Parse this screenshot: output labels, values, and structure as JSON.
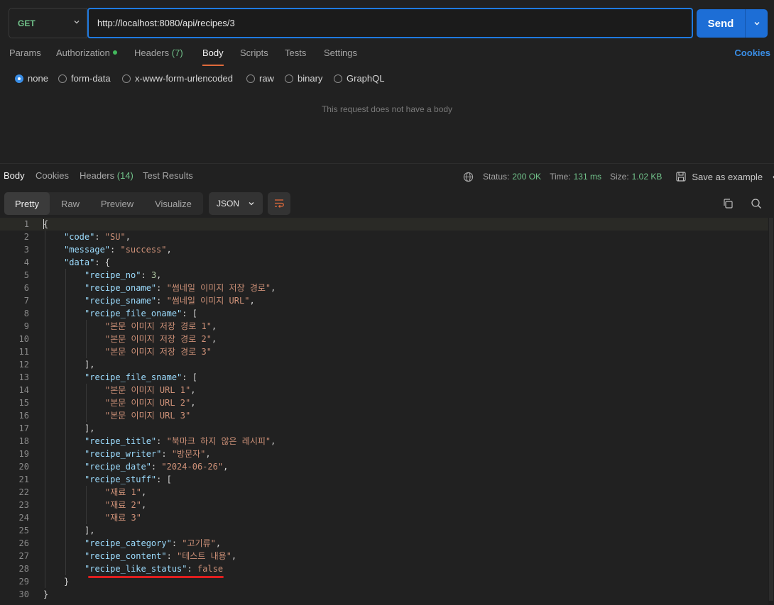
{
  "request": {
    "method": "GET",
    "url": "http://localhost:8080/api/recipes/3",
    "send_label": "Send"
  },
  "req_tabs": {
    "params": "Params",
    "authorization": "Authorization",
    "headers": "Headers",
    "headers_count": "(7)",
    "body": "Body",
    "scripts": "Scripts",
    "tests": "Tests",
    "settings": "Settings",
    "cookies": "Cookies"
  },
  "body_modes": [
    "none",
    "form-data",
    "x-www-form-urlencoded",
    "raw",
    "binary",
    "GraphQL"
  ],
  "no_body_text": "This request does not have a body",
  "response": {
    "tabs": {
      "body": "Body",
      "cookies": "Cookies",
      "headers": "Headers",
      "headers_count": "(14)",
      "test_results": "Test Results"
    },
    "status_label": "Status:",
    "status_value": "200 OK",
    "time_label": "Time:",
    "time_value": "131 ms",
    "size_label": "Size:",
    "size_value": "1.02 KB",
    "save_example": "Save as example"
  },
  "viewer": {
    "modes": [
      "Pretty",
      "Raw",
      "Preview",
      "Visualize"
    ],
    "format": "JSON"
  },
  "json_lines": [
    {
      "n": "1",
      "i": 0,
      "t": [
        [
          "p",
          "{"
        ]
      ]
    },
    {
      "n": "2",
      "i": 1,
      "t": [
        [
          "k",
          "\"code\""
        ],
        [
          "p",
          ": "
        ],
        [
          "s",
          "\"SU\""
        ],
        [
          "p",
          ","
        ]
      ]
    },
    {
      "n": "3",
      "i": 1,
      "t": [
        [
          "k",
          "\"message\""
        ],
        [
          "p",
          ": "
        ],
        [
          "s",
          "\"success\""
        ],
        [
          "p",
          ","
        ]
      ]
    },
    {
      "n": "4",
      "i": 1,
      "t": [
        [
          "k",
          "\"data\""
        ],
        [
          "p",
          ": {"
        ]
      ]
    },
    {
      "n": "5",
      "i": 2,
      "t": [
        [
          "k",
          "\"recipe_no\""
        ],
        [
          "p",
          ": "
        ],
        [
          "n",
          "3"
        ],
        [
          "p",
          ","
        ]
      ]
    },
    {
      "n": "6",
      "i": 2,
      "t": [
        [
          "k",
          "\"recipe_oname\""
        ],
        [
          "p",
          ": "
        ],
        [
          "s",
          "\"썸네일 이미지 저장 경로\""
        ],
        [
          "p",
          ","
        ]
      ]
    },
    {
      "n": "7",
      "i": 2,
      "t": [
        [
          "k",
          "\"recipe_sname\""
        ],
        [
          "p",
          ": "
        ],
        [
          "s",
          "\"썸네일 이미지 URL\""
        ],
        [
          "p",
          ","
        ]
      ]
    },
    {
      "n": "8",
      "i": 2,
      "t": [
        [
          "k",
          "\"recipe_file_oname\""
        ],
        [
          "p",
          ": ["
        ]
      ]
    },
    {
      "n": "9",
      "i": 3,
      "t": [
        [
          "s",
          "\"본문 이미지 저장 경로 1\""
        ],
        [
          "p",
          ","
        ]
      ]
    },
    {
      "n": "10",
      "i": 3,
      "t": [
        [
          "s",
          "\"본문 이미지 저장 경로 2\""
        ],
        [
          "p",
          ","
        ]
      ]
    },
    {
      "n": "11",
      "i": 3,
      "t": [
        [
          "s",
          "\"본문 이미지 저장 경로 3\""
        ]
      ]
    },
    {
      "n": "12",
      "i": 2,
      "t": [
        [
          "p",
          "],"
        ]
      ]
    },
    {
      "n": "13",
      "i": 2,
      "t": [
        [
          "k",
          "\"recipe_file_sname\""
        ],
        [
          "p",
          ": ["
        ]
      ]
    },
    {
      "n": "14",
      "i": 3,
      "t": [
        [
          "s",
          "\"본문 이미지 URL 1\""
        ],
        [
          "p",
          ","
        ]
      ]
    },
    {
      "n": "15",
      "i": 3,
      "t": [
        [
          "s",
          "\"본문 이미지 URL 2\""
        ],
        [
          "p",
          ","
        ]
      ]
    },
    {
      "n": "16",
      "i": 3,
      "t": [
        [
          "s",
          "\"본문 이미지 URL 3\""
        ]
      ]
    },
    {
      "n": "17",
      "i": 2,
      "t": [
        [
          "p",
          "],"
        ]
      ]
    },
    {
      "n": "18",
      "i": 2,
      "t": [
        [
          "k",
          "\"recipe_title\""
        ],
        [
          "p",
          ": "
        ],
        [
          "s",
          "\"북마크 하지 않은 레시피\""
        ],
        [
          "p",
          ","
        ]
      ]
    },
    {
      "n": "19",
      "i": 2,
      "t": [
        [
          "k",
          "\"recipe_writer\""
        ],
        [
          "p",
          ": "
        ],
        [
          "s",
          "\"방문자\""
        ],
        [
          "p",
          ","
        ]
      ]
    },
    {
      "n": "20",
      "i": 2,
      "t": [
        [
          "k",
          "\"recipe_date\""
        ],
        [
          "p",
          ": "
        ],
        [
          "s",
          "\"2024-06-26\""
        ],
        [
          "p",
          ","
        ]
      ]
    },
    {
      "n": "21",
      "i": 2,
      "t": [
        [
          "k",
          "\"recipe_stuff\""
        ],
        [
          "p",
          ": ["
        ]
      ]
    },
    {
      "n": "22",
      "i": 3,
      "t": [
        [
          "s",
          "\"재료 1\""
        ],
        [
          "p",
          ","
        ]
      ]
    },
    {
      "n": "23",
      "i": 3,
      "t": [
        [
          "s",
          "\"재료 2\""
        ],
        [
          "p",
          ","
        ]
      ]
    },
    {
      "n": "24",
      "i": 3,
      "t": [
        [
          "s",
          "\"재료 3\""
        ]
      ]
    },
    {
      "n": "25",
      "i": 2,
      "t": [
        [
          "p",
          "],"
        ]
      ]
    },
    {
      "n": "26",
      "i": 2,
      "t": [
        [
          "k",
          "\"recipe_category\""
        ],
        [
          "p",
          ": "
        ],
        [
          "s",
          "\"고기류\""
        ],
        [
          "p",
          ","
        ]
      ]
    },
    {
      "n": "27",
      "i": 2,
      "t": [
        [
          "k",
          "\"recipe_content\""
        ],
        [
          "p",
          ": "
        ],
        [
          "s",
          "\"테스트 내용\""
        ],
        [
          "p",
          ","
        ]
      ]
    },
    {
      "n": "28",
      "i": 2,
      "t": [
        [
          "k",
          "\"recipe_like_status\""
        ],
        [
          "p",
          ": "
        ],
        [
          "b",
          "false"
        ]
      ]
    },
    {
      "n": "29",
      "i": 1,
      "t": [
        [
          "p",
          "}"
        ]
      ]
    },
    {
      "n": "30",
      "i": 0,
      "t": [
        [
          "p",
          "}"
        ]
      ]
    }
  ],
  "colors": {
    "accent": "#1d6ed6",
    "method_get": "#71c28a",
    "active_tab_underline": "#e06a3b",
    "status_ok": "#71c28a",
    "annotation_underline": "#e01e1e"
  }
}
